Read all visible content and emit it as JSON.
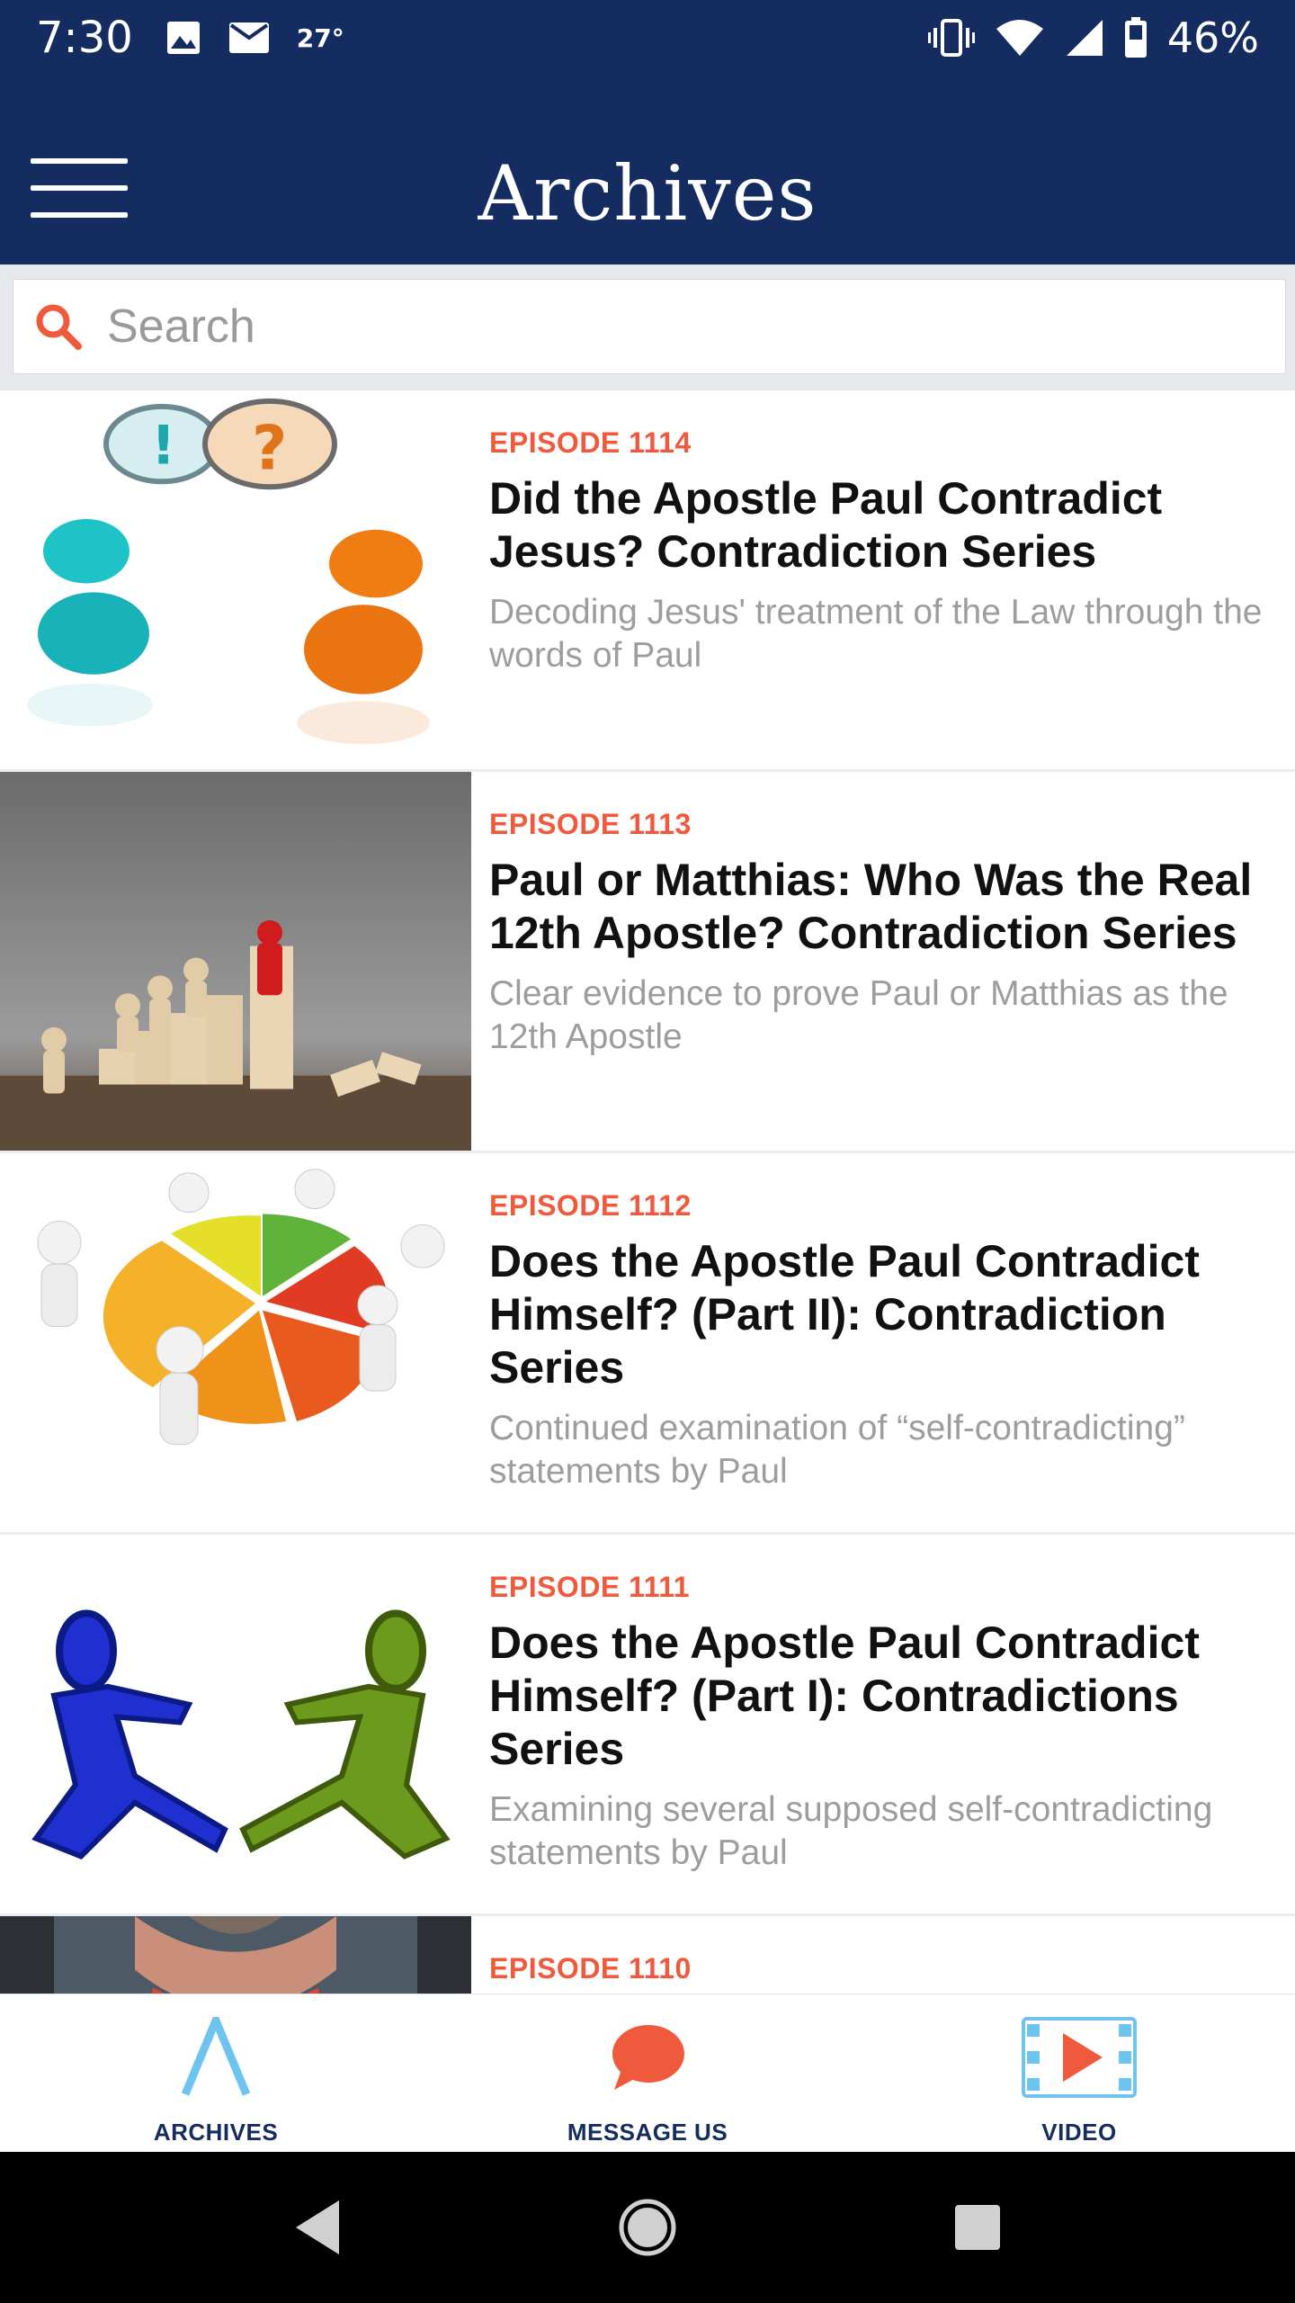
{
  "status_bar": {
    "time": "7:30",
    "temperature": "27°",
    "battery": "46%",
    "icons": [
      "image-icon",
      "mail-icon",
      "vibrate-icon",
      "wifi-icon",
      "signal-icon",
      "battery-icon"
    ]
  },
  "header": {
    "title": "Archives",
    "menu_icon": "hamburger-menu-icon"
  },
  "search": {
    "placeholder": "Search",
    "icon": "search-icon"
  },
  "episodes": [
    {
      "episode": "EPISODE 1114",
      "title": "Did the Apostle Paul Contradict Jesus? Contradiction Series",
      "description": "Decoding Jesus' treatment of the Law through the words of Paul",
      "thumbnail": "speech-bubble-figures-illustration"
    },
    {
      "episode": "EPISODE 1113",
      "title": "Paul or Matthias: Who Was the Real 12th Apostle? Contradiction Series",
      "description": "Clear evidence to prove Paul or Matthias as the 12th Apostle",
      "thumbnail": "wooden-figures-on-blocks-photo"
    },
    {
      "episode": "EPISODE 1112",
      "title": "Does the Apostle Paul Contradict Himself? (Part II): Contradiction Series",
      "description": "Continued examination of “self-contradicting” statements by Paul",
      "thumbnail": "figures-pushing-pie-chart-illustration"
    },
    {
      "episode": "EPISODE 1111",
      "title": "Does the Apostle Paul Contradict Himself? (Part I): Contradictions Series",
      "description": "Examining several supposed self-contradicting statements by Paul",
      "thumbnail": "blue-and-green-figures-pushing-illustration"
    },
    {
      "episode": "EPISODE 1110",
      "title": "",
      "description": "",
      "thumbnail": "man-portrait-photo"
    }
  ],
  "bottom_nav": {
    "items": [
      {
        "label": "ARCHIVES",
        "icon": "archives-logo-icon"
      },
      {
        "label": "MESSAGE US",
        "icon": "chat-bubble-icon"
      },
      {
        "label": "VIDEO",
        "icon": "video-play-icon"
      }
    ]
  },
  "colors": {
    "header_bg": "#142c5f",
    "accent": "#ef5a3c",
    "nav_label": "#142c5f",
    "light_blue": "#6ec3ef"
  }
}
